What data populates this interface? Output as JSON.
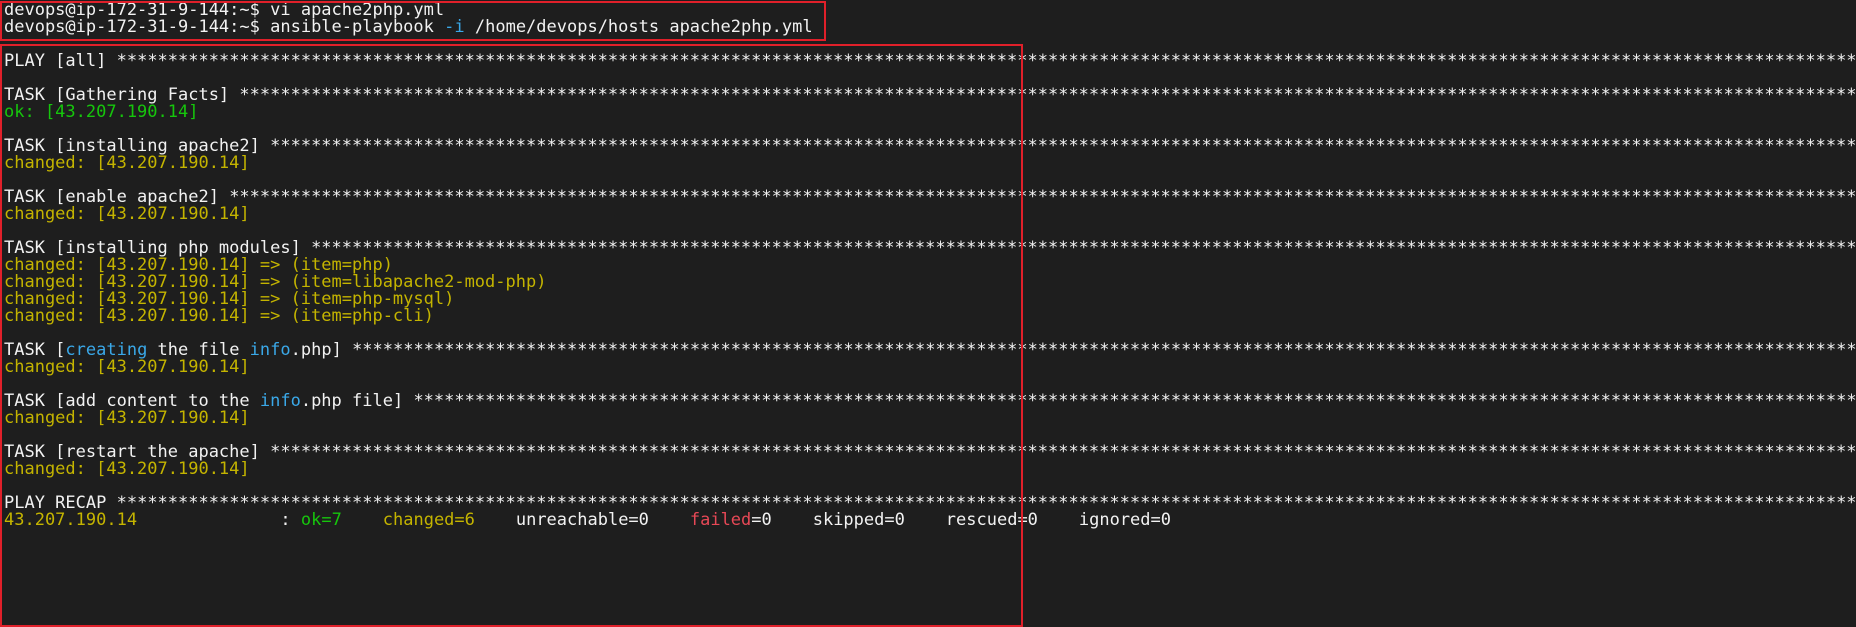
{
  "prompt": {
    "user_host": "devops@ip-172-31-9-144:~$",
    "cmd1": "vi apache2php.yml",
    "cmd2_pre": "ansible-playbook",
    "cmd2_flag": "-i",
    "cmd2_post": "/home/devops/hosts apache2php.yml"
  },
  "stars": "**********************************************************************************************************************************************************************************************************",
  "play": {
    "label": "PLAY [all]"
  },
  "tasks": [
    {
      "label": "TASK [Gathering Facts]",
      "result": "ok: [43.207.190.14]"
    },
    {
      "label": "TASK [installing apache2]",
      "result": "changed: [43.207.190.14]"
    },
    {
      "label": "TASK [enable apache2]",
      "result": "changed: [43.207.190.14]"
    },
    {
      "label": "TASK [installing php modules]",
      "items": [
        "changed: [43.207.190.14] => (item=php)",
        "changed: [43.207.190.14] => (item=libapache2-mod-php)",
        "changed: [43.207.190.14] => (item=php-mysql)",
        "changed: [43.207.190.14] => (item=php-cli)"
      ]
    },
    {
      "label_parts": [
        "TASK [",
        "creating",
        " the file ",
        "info",
        ".php]"
      ],
      "result": "changed: [43.207.190.14]"
    },
    {
      "label_parts": [
        "TASK [add content to the ",
        "info",
        ".php file]"
      ],
      "result": "changed: [43.207.190.14]"
    },
    {
      "label": "TASK [restart the apache]",
      "result": "changed: [43.207.190.14]"
    }
  ],
  "recap": {
    "label": "PLAY RECAP",
    "host": "43.207.190.14",
    "sep": ":",
    "ok": "ok=7",
    "changed": "changed=6",
    "unreachable": "unreachable=0",
    "failed_key": "failed",
    "failed_val": "=0",
    "skipped": "skipped=0",
    "rescued": "rescued=0",
    "ignored": "ignored=0"
  },
  "colors": {
    "background": "#1e1e1e",
    "ok": "#16c60c",
    "changed": "#c4b400",
    "highlight": "#3aa8e8",
    "failed": "#e74856",
    "annotation_box": "#e0202a"
  }
}
